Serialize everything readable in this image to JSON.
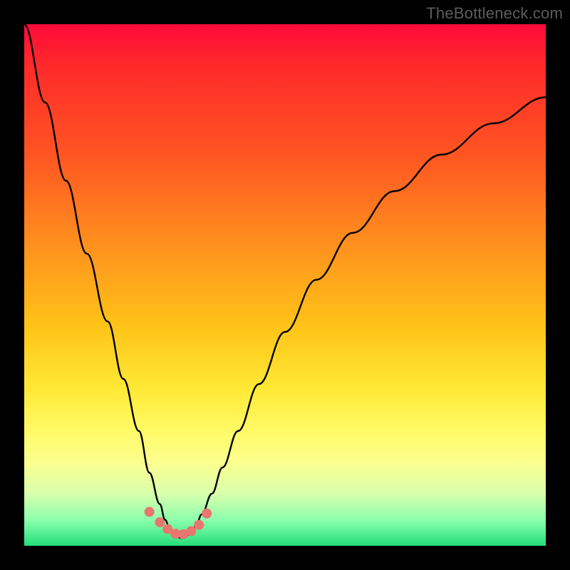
{
  "watermark": "TheBottleneck.com",
  "chart_data": {
    "type": "line",
    "title": "",
    "xlabel": "",
    "ylabel": "",
    "xlim": [
      0,
      100
    ],
    "ylim": [
      0,
      100
    ],
    "background_gradient": {
      "top_color": "#ff0a3a",
      "bottom_color": "#22e07a",
      "meaning": "value from high (red, worse) to low (green, better)"
    },
    "series": [
      {
        "name": "bottleneck-curve",
        "x": [
          0,
          4,
          8,
          12,
          16,
          19,
          22,
          24,
          26,
          27,
          28,
          29,
          30,
          31,
          32,
          33,
          34,
          36,
          38,
          41,
          45,
          50,
          56,
          63,
          71,
          80,
          90,
          100
        ],
        "values": [
          100,
          85,
          70,
          56,
          43,
          32,
          22,
          14,
          8,
          5,
          3,
          2,
          1.5,
          1.8,
          2.5,
          4,
          6,
          10,
          15,
          22,
          31,
          41,
          51,
          60,
          68,
          75,
          81,
          86
        ]
      }
    ],
    "markers": {
      "name": "pink-dots-near-minimum",
      "x": [
        24,
        26,
        27.5,
        29,
        30.5,
        32,
        33.5,
        35
      ],
      "values": [
        6.5,
        4.5,
        3.2,
        2.3,
        2.2,
        2.8,
        4.0,
        6.2
      ],
      "color": "#e9756f"
    },
    "minimum_at_x": 30
  }
}
